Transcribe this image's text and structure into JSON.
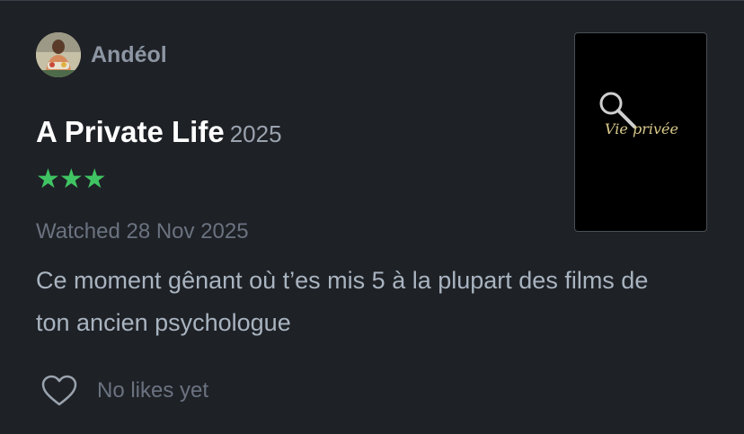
{
  "user": {
    "name": "Andéol",
    "avatar_icon": "user-photo-avatar"
  },
  "film": {
    "title": "A Private Life",
    "year": "2025",
    "rating_stars": 3,
    "rating_display": "★★★",
    "poster_title": "Vie privée"
  },
  "entry": {
    "watched": "Watched 28 Nov 2025",
    "review": "Ce moment gênant où t’es mis 5 à la plupart des films de ton ancien psychologue"
  },
  "likes": {
    "text": "No likes yet",
    "icon": "heart-icon"
  },
  "colors": {
    "background": "#1e2126",
    "star": "#40c463",
    "username": "#8d96a3",
    "muted": "#6b7380",
    "review": "#a9b4c0"
  }
}
